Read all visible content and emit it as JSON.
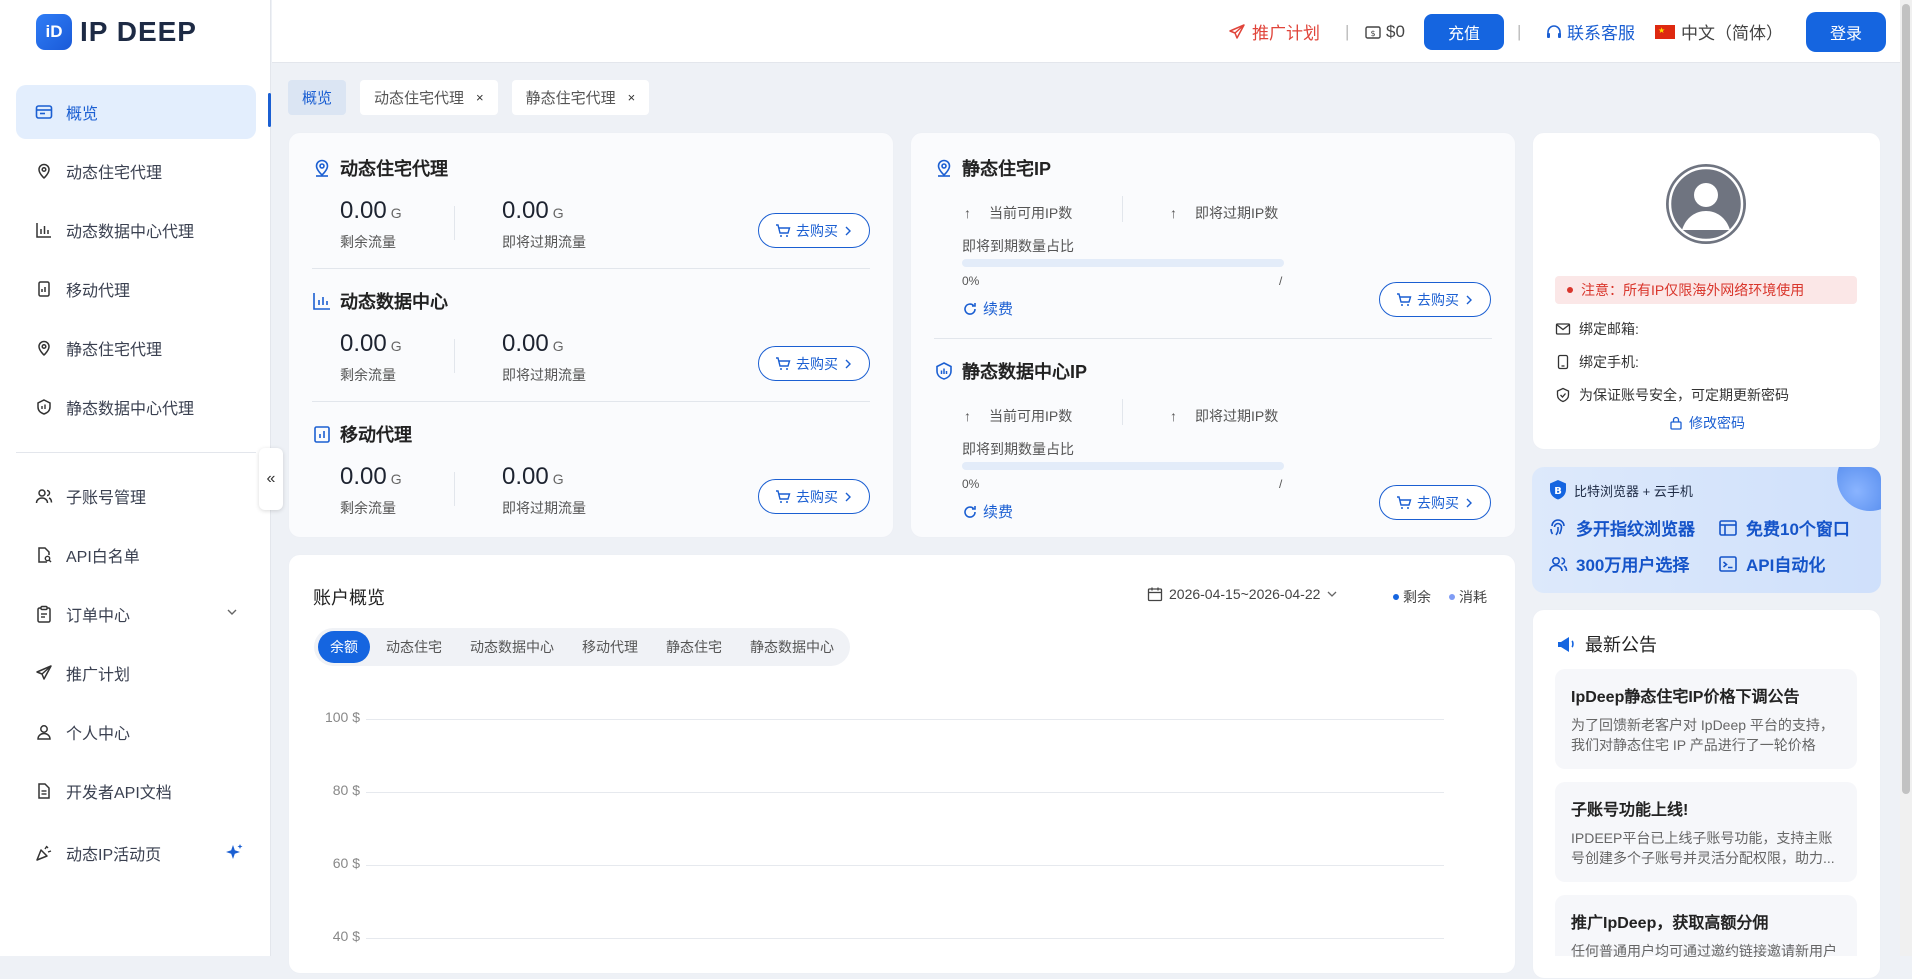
{
  "brand": {
    "name": "IP DEEP",
    "mark": "iD"
  },
  "sidebar": {
    "items": [
      {
        "label": "概览",
        "icon": "dashboard-icon"
      },
      {
        "label": "动态住宅代理",
        "icon": "location-pin-icon"
      },
      {
        "label": "动态数据中心代理",
        "icon": "bar-chart-icon"
      },
      {
        "label": "移动代理",
        "icon": "mobile-icon"
      },
      {
        "label": "静态住宅代理",
        "icon": "location-pin-icon"
      },
      {
        "label": "静态数据中心代理",
        "icon": "shield-chart-icon"
      },
      {
        "label": "子账号管理",
        "icon": "users-icon"
      },
      {
        "label": "API白名单",
        "icon": "document-search-icon"
      },
      {
        "label": "订单中心",
        "icon": "clipboard-icon"
      },
      {
        "label": "推广计划",
        "icon": "send-icon"
      },
      {
        "label": "个人中心",
        "icon": "user-icon"
      },
      {
        "label": "开发者API文档",
        "icon": "document-icon"
      },
      {
        "label": "动态IP活动页",
        "icon": "party-icon"
      }
    ],
    "collapse": "«"
  },
  "topbar": {
    "promo": "推广计划",
    "balance": "$0",
    "recharge": "充值",
    "support": "联系客服",
    "language": "中文（简体）",
    "login": "登录"
  },
  "tabs": [
    {
      "label": "概览"
    },
    {
      "label": "动态住宅代理",
      "close": "×"
    },
    {
      "label": "静态住宅代理",
      "close": "×"
    }
  ],
  "dynamic_card": {
    "sections": [
      {
        "title": "动态住宅代理",
        "remaining": "0.00",
        "expiring": "0.00"
      },
      {
        "title": "动态数据中心",
        "remaining": "0.00",
        "expiring": "0.00"
      },
      {
        "title": "移动代理",
        "remaining": "0.00",
        "expiring": "0.00"
      }
    ],
    "unit": "G",
    "remaining_label": "剩余流量",
    "expiring_label": "即将过期流量",
    "buy_label": "去购买"
  },
  "static_card": {
    "sections": [
      {
        "title": "静态住宅IP"
      },
      {
        "title": "静态数据中心IP"
      }
    ],
    "available_label": "当前可用IP数",
    "expiring_label": "即将过期IP数",
    "ratio_label": "即将到期数量占比",
    "ratio_value": "0%",
    "ratio_max": "/",
    "renew_label": "续费",
    "buy_label": "去购买"
  },
  "account_overview": {
    "title": "账户概览",
    "date_range": "2026-04-15~2026-04-22",
    "legend_remaining": "剩余",
    "legend_consumed": "消耗",
    "pills": [
      "余额",
      "动态住宅",
      "动态数据中心",
      "移动代理",
      "静态住宅",
      "静态数据中心"
    ],
    "y_ticks": [
      "100 $",
      "80 $",
      "60 $",
      "40 $"
    ]
  },
  "profile": {
    "warning": "注意：所有IP仅限海外网络环境使用",
    "email_label": "绑定邮箱:",
    "phone_label": "绑定手机:",
    "security_tip": "为保证账号安全，可定期更新密码",
    "change_password": "修改密码"
  },
  "banner": {
    "brand": "比特浏览器 + 云手机",
    "feature1": "多开指纹浏览器",
    "feature2": "免费10个窗口",
    "feature3": "300万用户选择",
    "feature4": "API自动化"
  },
  "announcements": {
    "title": "最新公告",
    "items": [
      {
        "title": "IpDeep静态住宅IP价格下调公告",
        "desc": "为了回馈新老客户对 IpDeep 平台的支持，我们对静态住宅 IP 产品进行了一轮价格调..."
      },
      {
        "title": "子账号功能上线!",
        "desc": "IPDEEP平台已上线子账号功能，支持主账号创建多个子账号并灵活分配权限，助力..."
      },
      {
        "title": "推广IpDeep，获取高额分佣",
        "desc": "任何普通用户均可通过邀约链接邀请新用户"
      }
    ]
  },
  "chart_data": {
    "type": "line",
    "title": "账户概览",
    "ylabel": "",
    "y_ticks": [
      100,
      80,
      60,
      40
    ],
    "legend": [
      "剩余",
      "消耗"
    ],
    "series": []
  },
  "colors": {
    "accent": "#1565e0",
    "warning": "#e0443a",
    "promo": "#e0443a"
  }
}
